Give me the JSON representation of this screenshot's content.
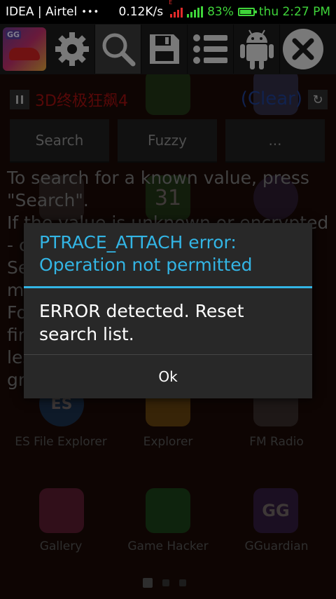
{
  "status_bar": {
    "carriers": "IDEA | Airtel",
    "dots": "•••",
    "speed": "0.12K/s",
    "battery": "83%",
    "time": "thu 2:27 PM",
    "sim_badge": "E"
  },
  "toolbar": {
    "icons": [
      "gameguardian-app-icon",
      "settings-gear-icon",
      "search-icon",
      "save-icon",
      "list-icon",
      "android-icon",
      "close-icon"
    ],
    "badge": "GG"
  },
  "titlebar": {
    "process_name": "3D终极狂飙4",
    "clear_label": "(Clear)"
  },
  "buttons": {
    "search": "Search",
    "fuzzy": "Fuzzy",
    "more": "..."
  },
  "help_text": [
    "To search for a known value, press",
    "\"Search\".",
    "If the value is unknown or encrypted",
    "- c",
    "Se",
    "ma",
    "Fo",
    "fir",
    "les",
    "gr"
  ],
  "home_screen": {
    "calendar_day": "31",
    "apps": [
      {
        "label": "ES File Explorer",
        "badge": "ES"
      },
      {
        "label": "Explorer",
        "badge": ""
      },
      {
        "label": "FM Radio",
        "badge": ""
      },
      {
        "label": "Gallery",
        "badge": ""
      },
      {
        "label": "Game Hacker",
        "badge": ""
      },
      {
        "label": "GGuardian",
        "badge": "GG"
      }
    ]
  },
  "dialog": {
    "title": "PTRACE_ATTACH error: Operation not permitted",
    "message": "ERROR detected. Reset search list.",
    "ok_label": "Ok"
  },
  "colors": {
    "accent": "#33b5e5",
    "status_green": "#3fd43a",
    "process_red": "#9e1010",
    "clear_blue": "#1f3f8f"
  }
}
